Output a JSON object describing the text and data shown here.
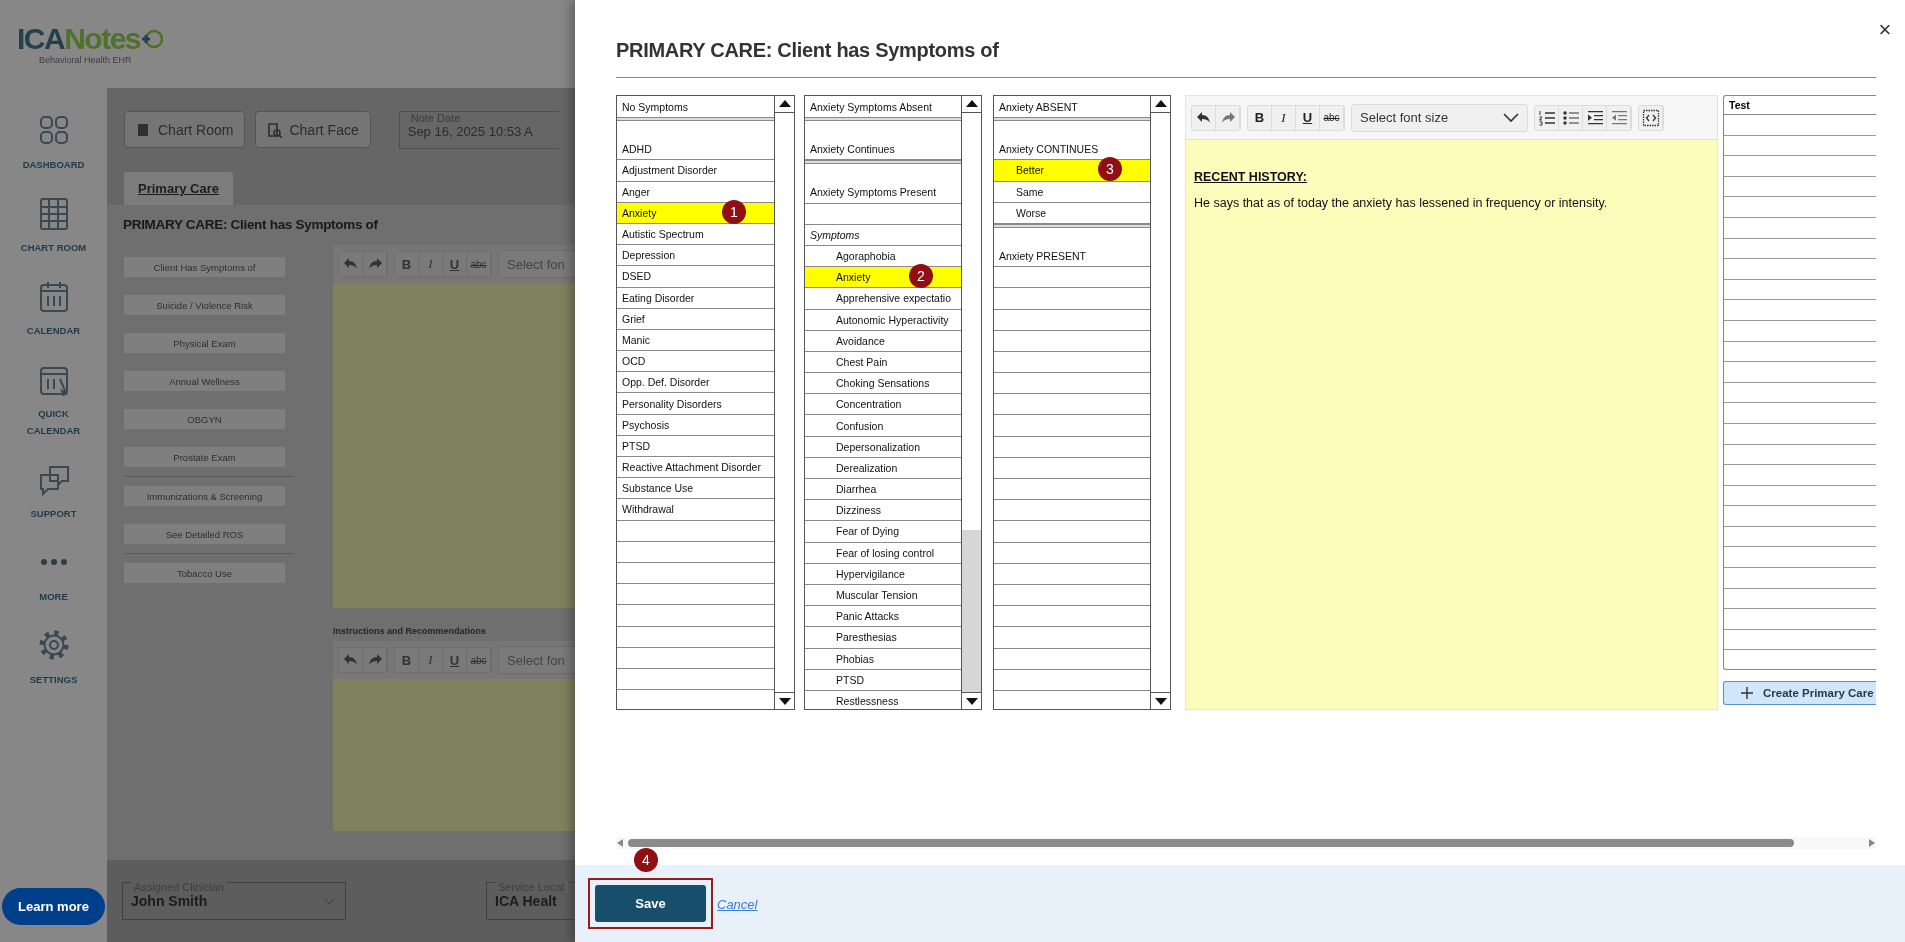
{
  "app": {
    "logo": {
      "first": "ICA",
      "second": "Notes",
      "tagline": "Behavioral Health EHR"
    },
    "nav": [
      {
        "kind": "dashboard",
        "label": "DASHBOARD"
      },
      {
        "kind": "chart-room",
        "label": "CHART ROOM"
      },
      {
        "kind": "calendar",
        "label": "CALENDAR"
      },
      {
        "kind": "quick-calendar",
        "label": "QUICK CALENDAR"
      },
      {
        "kind": "support",
        "label": "SUPPORT"
      },
      {
        "kind": "more",
        "label": "MORE"
      },
      {
        "kind": "settings",
        "label": "SETTINGS"
      }
    ],
    "learn_more": "Learn more",
    "top_buttons": [
      {
        "kind": "chart-room",
        "label": "Chart Room"
      },
      {
        "kind": "chart-face",
        "label": "Chart Face"
      }
    ],
    "note_date": {
      "label": "Note Date",
      "value": "Sep 16, 2025 10:53 A"
    },
    "tabs": [
      {
        "label": "Primary Care",
        "selected": true
      }
    ],
    "heading": "PRIMARY CARE: Client has Symptoms of",
    "section_buttons": [
      {
        "kind": "button",
        "label": "Client Has Symptoms of"
      },
      {
        "kind": "button",
        "label": "Suicide / Violence Risk"
      },
      {
        "kind": "button",
        "label": "Physical Exam"
      },
      {
        "kind": "button",
        "label": "Annual Wellness"
      },
      {
        "kind": "button",
        "label": "OBGYN"
      },
      {
        "kind": "button",
        "label": "Prostate Exam"
      },
      {
        "kind": "divider"
      },
      {
        "kind": "button",
        "label": "Immunizations & Screening"
      },
      {
        "kind": "button",
        "label": "See Detailed ROS"
      },
      {
        "kind": "divider"
      },
      {
        "kind": "button",
        "label": "Tobacco Use"
      }
    ],
    "editors": [
      {
        "toolbar": [
          [
            {
              "kind": "undo"
            },
            {
              "kind": "redo"
            }
          ],
          [
            {
              "kind": "bold",
              "label": "B"
            },
            {
              "kind": "italic",
              "label": "I"
            },
            {
              "kind": "underline",
              "label": "U"
            },
            {
              "kind": "strike",
              "label": "abc"
            }
          ],
          [
            {
              "kind": "select",
              "placeholder": "Select fon"
            }
          ]
        ]
      },
      {
        "label": "Instructions and Recommendations",
        "toolbar": [
          [
            {
              "kind": "undo"
            },
            {
              "kind": "redo"
            }
          ],
          [
            {
              "kind": "bold",
              "label": "B"
            },
            {
              "kind": "italic",
              "label": "I"
            },
            {
              "kind": "underline",
              "label": "U"
            },
            {
              "kind": "strike",
              "label": "abc"
            }
          ],
          [
            {
              "kind": "select",
              "placeholder": "Select fon"
            }
          ]
        ]
      }
    ],
    "bottom_fields": [
      {
        "label": "Assigned Clinician",
        "value": "John Smith",
        "dropdown": true
      },
      {
        "label": "Service Locat",
        "value": "ICA Healt"
      }
    ]
  },
  "modal": {
    "title": "PRIMARY CARE: Client has Symptoms of",
    "close": "×",
    "lists": [
      {
        "header": "No Symptoms",
        "scrolled": false,
        "items": [
          {
            "kind": "separator"
          },
          {
            "kind": "spacer"
          },
          {
            "kind": "item",
            "label": "ADHD",
            "selected": false
          },
          {
            "kind": "item",
            "label": "Adjustment Disorder",
            "selected": false
          },
          {
            "kind": "item",
            "label": "Anger",
            "selected": false
          },
          {
            "kind": "item",
            "label": "Anxiety",
            "selected": true,
            "badge": "1"
          },
          {
            "kind": "item",
            "label": "Autistic Spectrum",
            "selected": false
          },
          {
            "kind": "item",
            "label": "Depression",
            "selected": false
          },
          {
            "kind": "item",
            "label": "DSED",
            "selected": false
          },
          {
            "kind": "item",
            "label": "Eating Disorder",
            "selected": false
          },
          {
            "kind": "item",
            "label": "Grief",
            "selected": false
          },
          {
            "kind": "item",
            "label": "Manic",
            "selected": false
          },
          {
            "kind": "item",
            "label": "OCD",
            "selected": false
          },
          {
            "kind": "item",
            "label": "Opp. Def. Disorder",
            "selected": false
          },
          {
            "kind": "item",
            "label": "Personality Disorders",
            "selected": false
          },
          {
            "kind": "item",
            "label": "Psychosis",
            "selected": false
          },
          {
            "kind": "item",
            "label": "PTSD",
            "selected": false
          },
          {
            "kind": "item",
            "label": "Reactive Attachment Disorder",
            "selected": false
          },
          {
            "kind": "item",
            "label": "Substance Use",
            "selected": false
          },
          {
            "kind": "item",
            "label": "Withdrawal",
            "selected": false
          }
        ]
      },
      {
        "header": "Anxiety Symptoms Absent",
        "scrolled": true,
        "items": [
          {
            "kind": "separator"
          },
          {
            "kind": "spacer"
          },
          {
            "kind": "item",
            "label": "Anxiety Continues",
            "selected": false
          },
          {
            "kind": "separator"
          },
          {
            "kind": "spacer"
          },
          {
            "kind": "item",
            "label": "Anxiety Symptoms Present",
            "selected": false
          },
          {
            "kind": "blank"
          },
          {
            "kind": "heading",
            "label": "Symptoms",
            "children": [
              {
                "label": "Agoraphobia",
                "selected": false
              },
              {
                "label": "Anxiety",
                "selected": true,
                "badge": "2"
              },
              {
                "label": "Apprehensive expectatio",
                "selected": false
              },
              {
                "label": "Autonomic Hyperactivity",
                "selected": false
              },
              {
                "label": "Avoidance",
                "selected": false
              },
              {
                "label": "Chest Pain",
                "selected": false
              },
              {
                "label": "Choking Sensations",
                "selected": false
              },
              {
                "label": "Concentration",
                "selected": false
              },
              {
                "label": "Confusion",
                "selected": false
              },
              {
                "label": "Depersonalization",
                "selected": false
              },
              {
                "label": "Derealization",
                "selected": false
              },
              {
                "label": "Diarrhea",
                "selected": false
              },
              {
                "label": "Dizziness",
                "selected": false
              },
              {
                "label": "Fear of Dying",
                "selected": false
              },
              {
                "label": "Fear of losing control",
                "selected": false
              },
              {
                "label": "Hypervigilance",
                "selected": false
              },
              {
                "label": "Muscular Tension",
                "selected": false
              },
              {
                "label": "Panic Attacks",
                "selected": false
              },
              {
                "label": "Paresthesias",
                "selected": false
              },
              {
                "label": "Phobias",
                "selected": false
              },
              {
                "label": "PTSD",
                "selected": false
              },
              {
                "label": "Restlessness",
                "selected": false
              }
            ]
          }
        ]
      },
      {
        "header": "Anxiety ABSENT",
        "scrolled": false,
        "items": [
          {
            "kind": "separator"
          },
          {
            "kind": "spacer"
          },
          {
            "kind": "item",
            "label": "Anxiety CONTINUES",
            "selected": false,
            "children": [
              {
                "label": "Better",
                "selected": true,
                "badge": "3"
              },
              {
                "label": "Same",
                "selected": false
              },
              {
                "label": "Worse",
                "selected": false
              }
            ]
          },
          {
            "kind": "separator"
          },
          {
            "kind": "spacer"
          },
          {
            "kind": "item",
            "label": "Anxiety PRESENT",
            "selected": false
          }
        ]
      }
    ],
    "editor": {
      "toolbar": [
        [
          {
            "kind": "undo"
          },
          {
            "kind": "redo"
          }
        ],
        [
          {
            "kind": "bold",
            "label": "B"
          },
          {
            "kind": "italic",
            "label": "I"
          },
          {
            "kind": "underline",
            "label": "U"
          },
          {
            "kind": "strike",
            "label": "abc"
          }
        ],
        [
          {
            "kind": "select",
            "placeholder": "Select font size"
          }
        ],
        [
          {
            "kind": "ordered-list"
          },
          {
            "kind": "bullet-list"
          },
          {
            "kind": "indent"
          },
          {
            "kind": "outdent"
          }
        ],
        [
          {
            "kind": "source"
          }
        ]
      ],
      "heading": "RECENT HISTORY:",
      "text": "He says that as of today the anxiety has lessened in frequency or intensity."
    },
    "side_panel": {
      "header": "Test",
      "create_button": "Create Primary Care"
    },
    "footer": {
      "save": {
        "label": "Save",
        "badge": "4",
        "highlighted": true
      },
      "cancel": "Cancel"
    }
  }
}
